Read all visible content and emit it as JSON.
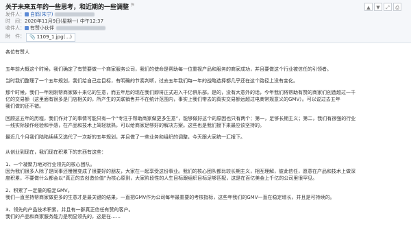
{
  "header": {
    "subject": "关于未来五年的一些思考，和近期的一些调整",
    "sender_label": "发件人：",
    "sender_name": "自鹤(朱宁)",
    "time_label": "时　间：",
    "time_value": "2020年11月9日(星期一) 中午12:37",
    "recipient_label": "收件人：",
    "recipient_value": "有赞小伙伴",
    "attachment_label": "附　件：",
    "attachment_name": "1109_1.jpg",
    "attachment_suffix": "(…)"
  },
  "toolbar": {
    "up_icon": "▲",
    "down_icon": "▼",
    "expand_icon": "⤢",
    "print_icon": "⎙"
  },
  "body": {
    "greeting": "各位有赞人",
    "p1": "五年前大概这个时候，我们确定了有赞要做一个商家服务公司，我们的使命是帮助每一位重视产品和服务的商家成功，并且要做这个行业被信任的引领者。",
    "p2": "当时我们整理了一个五年规划，我们给自己定目标，有明确的节奏判断，过去五年我们每一年的战略选择都几乎还在这个路径上没有变化。",
    "p3a": "那个时候，我们一年刚刚帮商家做十来亿的生意，而五年后的现在我们即将正式进入千亿俱乐部。是的，没有大意外的话，今年我们将帮助有赞的商家们创造超过一千",
    "p3b": "亿的交易额（这里面有很多是门店相关的，所产生的关联销售并不在统计范围内，事实上我们带去的真实交易额远超过电商常规意义的GMV）。可以说过去五年",
    "p3c": "我们做的还不错。",
    "p4a": "回顾这五年的历程，我们作对了的事情可能只有一个“专注于帮助商家做更多生意”，能够做好这个的原因也只有两个：第一，足够长期主义；第二，我们有很强的行业",
    "p4b": "一线实际操作经验和手感，在产品和技术上驾轻就熟，可以给商家足够好的解决方案。这些也是我们接下来最应该坚持的。",
    "p5": "最近几个月我们陆陆续续又选代了一次新的五年规划，并且做了一些业务和组织的调整，今天跟大家统一汇报下。",
    "p6": "从创业到现在，我们现在积累下的东西有这些：",
    "p7a": "1、一个凝聚力地对行业领先的核心团队。",
    "p7b": "因为我们很多人除了是同事还慢慢变成了很要好的朋友，大家在一起享受这份事业。我们的核心团队都比较长期主义，相互理解，彼此信任，愿意在产品和技术上做深",
    "p7c": "度积累，不要做什么都会以“真正的去创造价值”为核心原则，大家阶段性的人生目标跟组织目标足够匹配，这是在百亿美金上千亿的公司里很罕见。",
    "p8a": "2、积累了一定量的稳定GMV。",
    "p8b": "我们一直坚持帮商家做更多的生意才是最关键的结果，一直把GMV作为公司每年最重要的考核指标，这些年我们的GMV一直在稳定增长，并且是可持续的。",
    "p9a": "3、领先的产品技术积累，并且有一群真正信任有赞的客户。",
    "p9b": "我们的产品和商家服务能力是明显领先的，这是在……"
  }
}
